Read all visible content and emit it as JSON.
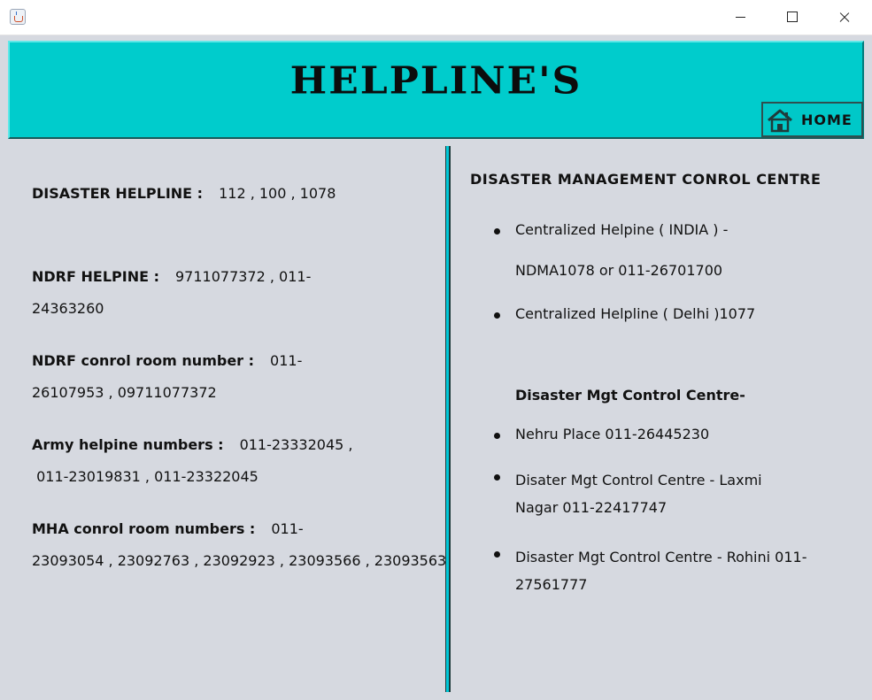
{
  "window": {
    "icon": "java-cup-icon",
    "controls": [
      "minimize",
      "maximize",
      "close"
    ]
  },
  "header": {
    "title": "HELPLINE'S",
    "home_label": "HOME",
    "home_icon": "home-icon",
    "background_color": "#00cccc"
  },
  "left": {
    "entries": [
      {
        "label": "DISASTER HELPLINE :",
        "line1": "112 , 100 , 1078",
        "line2": ""
      },
      {
        "label": "NDRF HELPINE :",
        "line1": "9711077372 , 011-",
        "line2": "24363260"
      },
      {
        "label": "NDRF conrol room number :",
        "line1": "011-",
        "line2": "26107953 , 09711077372"
      },
      {
        "label": "Army helpine numbers :",
        "line1": "011-23332045 ,",
        "line2": " 011-23019831 , 011-23322045"
      },
      {
        "label": "MHA conrol room numbers :",
        "line1": "011-",
        "line2": "23093054 , 23092763 , 23092923 , 23093566 , 23093563"
      }
    ]
  },
  "right": {
    "title": "DISASTER MANAGEMENT CONROL CENTRE",
    "items": [
      {
        "line1": "Centralized Helpine ( INDIA ) -",
        "line2": "NDMA1078 or 011-26701700"
      },
      {
        "line1": "Centralized Helpline ( Delhi )1077",
        "line2": ""
      }
    ],
    "subheading": "Disaster Mgt Control Centre-",
    "centres": [
      {
        "line1": "Nehru Place 011-26445230",
        "line2": ""
      },
      {
        "line1": "Disater Mgt Control Centre - Laxmi",
        "line2": "Nagar 011-22417747"
      },
      {
        "line1": "Disaster Mgt Control Centre - Rohini 011-",
        "line2": "27561777"
      }
    ]
  }
}
